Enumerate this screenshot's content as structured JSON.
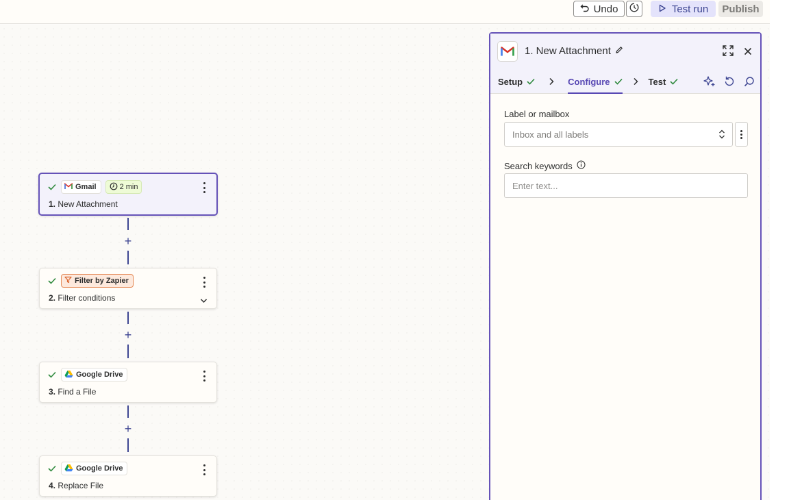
{
  "toolbar": {
    "undo_label": "Undo",
    "test_run_label": "Test run",
    "publish_label": "Publish"
  },
  "nodes": [
    {
      "app": "Gmail",
      "time": "2 min",
      "step": "1.",
      "title": "New Attachment"
    },
    {
      "app": "Filter by Zapier",
      "step": "2.",
      "title": "Filter conditions"
    },
    {
      "app": "Google Drive",
      "step": "3.",
      "title": "Find a File"
    },
    {
      "app": "Google Drive",
      "step": "4.",
      "title": "Replace File"
    }
  ],
  "panel": {
    "title": "1. New Attachment",
    "tabs": [
      "Setup",
      "Configure",
      "Test"
    ],
    "active_tab": "Configure",
    "fields": {
      "label_mailbox": {
        "label": "Label or mailbox",
        "placeholder": "Inbox and all labels"
      },
      "search_keywords": {
        "label": "Search keywords",
        "placeholder": "Enter text..."
      }
    }
  },
  "colors": {
    "accent": "#6552b8",
    "accent_dark": "#3d4592",
    "success": "#2f8a3e",
    "filter_orange": "#e58b59"
  },
  "icons": [
    "undo-icon",
    "history-icon",
    "play-icon",
    "check-icon",
    "gmail-icon",
    "clock-icon",
    "filter-icon",
    "google-drive-icon",
    "kebab-icon",
    "chevron-down-icon",
    "pencil-icon",
    "expand-icon",
    "close-icon",
    "chevron-right-icon",
    "ai-sparkle-icon",
    "refresh-icon",
    "search-icon",
    "info-icon",
    "up-down-icon"
  ]
}
